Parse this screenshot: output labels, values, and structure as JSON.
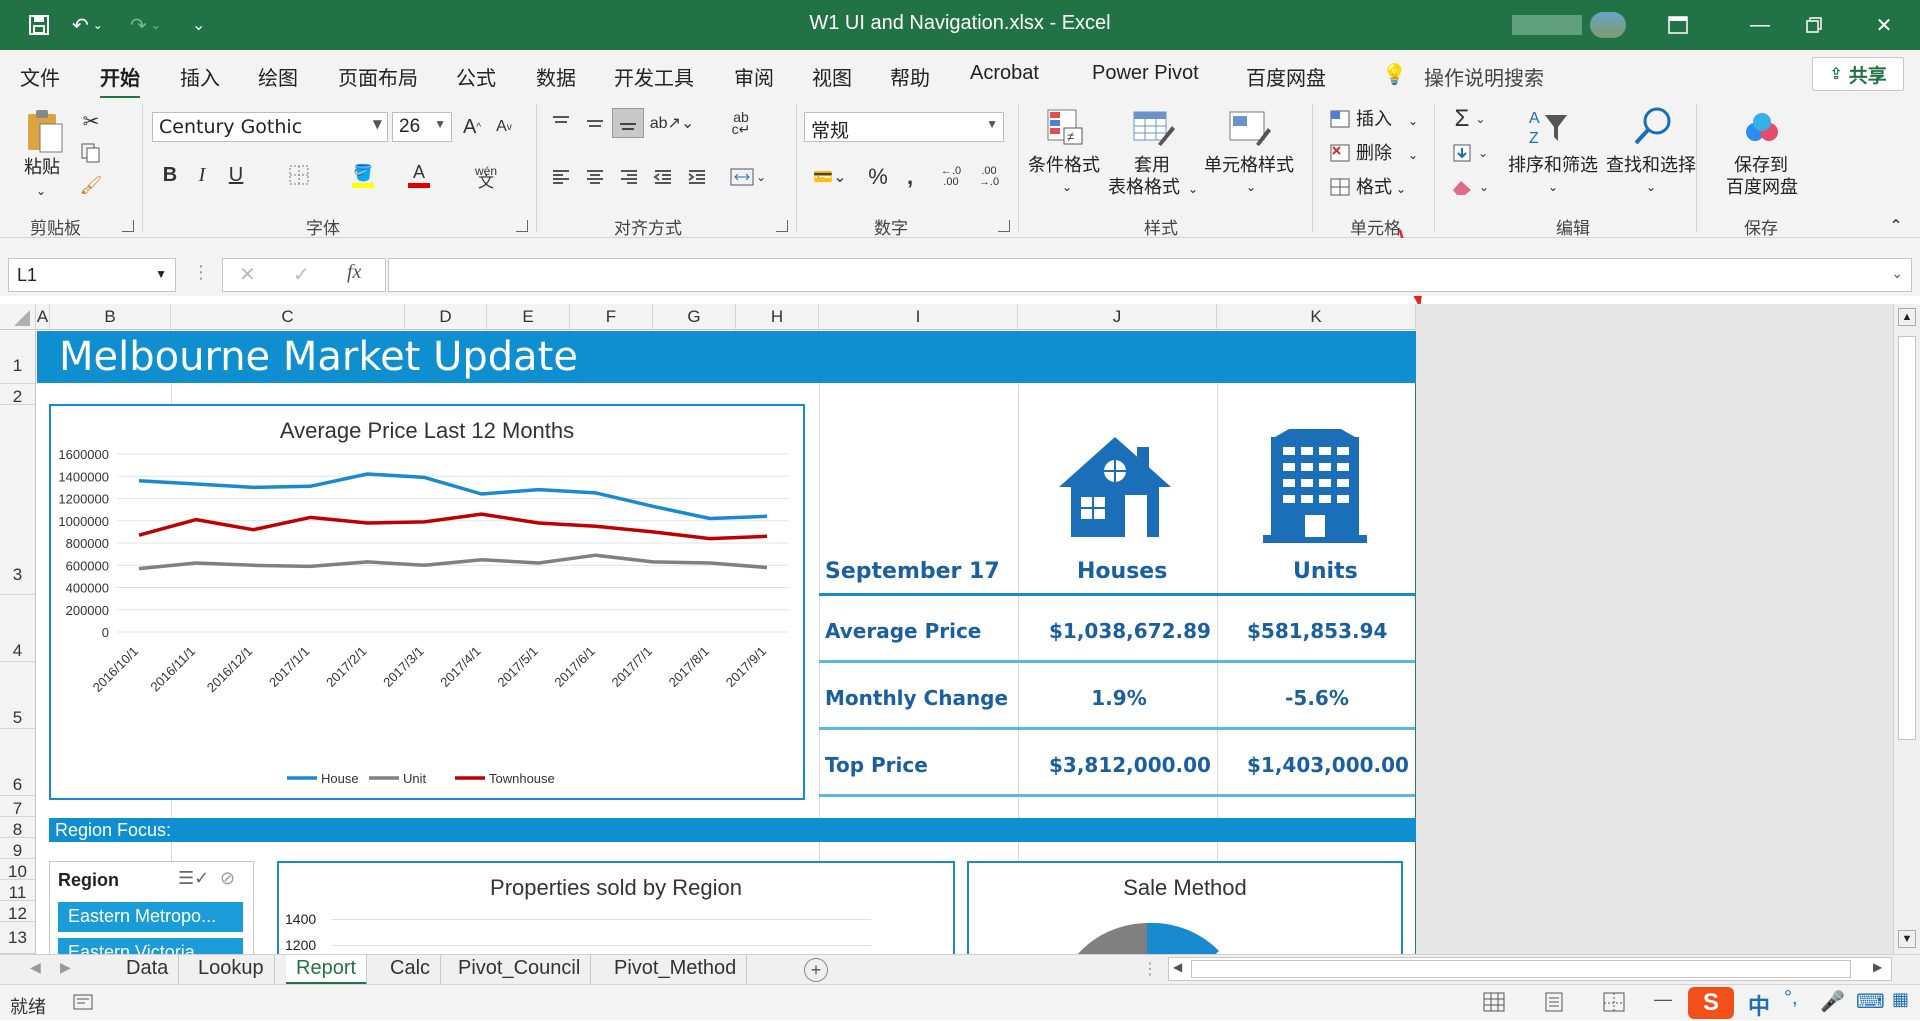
{
  "window": {
    "title": "W1 UI and Navigation.xlsx  -  Excel",
    "accent": "#217346"
  },
  "ribbon_tabs": [
    "文件",
    "开始",
    "插入",
    "绘图",
    "页面布局",
    "公式",
    "数据",
    "开发工具",
    "审阅",
    "视图",
    "帮助",
    "Acrobat",
    "Power Pivot",
    "百度网盘"
  ],
  "active_tab": "开始",
  "tell_me": "操作说明搜索",
  "share_label": "共享",
  "clipboard": {
    "paste": "粘贴",
    "group": "剪贴板"
  },
  "font": {
    "name": "Century Gothic",
    "size": "26",
    "group": "字体"
  },
  "alignment": {
    "group": "对齐方式"
  },
  "number": {
    "format": "常规",
    "group": "数字"
  },
  "styles": {
    "conditional": "条件格式",
    "table_line1": "套用",
    "table_line2": "表格格式",
    "cell_styles": "单元格样式",
    "group": "样式"
  },
  "cells": {
    "insert": "插入",
    "delete": "删除",
    "format": "格式",
    "group": "单元格"
  },
  "editing": {
    "sort": "排序和筛选",
    "find": "查找和选择",
    "group": "编辑"
  },
  "save": {
    "line1": "保存到",
    "line2": "百度网盘",
    "group": "保存"
  },
  "formula_bar": {
    "name_box": "L1",
    "formula": ""
  },
  "columns": [
    "A",
    "B",
    "C",
    "D",
    "E",
    "F",
    "G",
    "H",
    "I",
    "J",
    "K"
  ],
  "rows": [
    "1",
    "2",
    "3",
    "4",
    "5",
    "6",
    "7",
    "8",
    "9",
    "10",
    "11",
    "12",
    "13"
  ],
  "report": {
    "banner": "Melbourne Market Update",
    "period": "September 17",
    "col_houses": "Houses",
    "col_units": "Units",
    "rows": [
      {
        "label": "Average Price",
        "houses": "$1,038,672.89",
        "units": "$581,853.94"
      },
      {
        "label": "Monthly Change",
        "houses": "1.9%",
        "units": "-5.6%"
      },
      {
        "label": "Top Price",
        "houses": "$3,812,000.00",
        "units": "$1,403,000.00"
      }
    ],
    "region_focus": "Region Focus:",
    "slicer": {
      "title": "Region",
      "items": [
        "Eastern Metropo...",
        "Eastern Victoria"
      ]
    },
    "chart2_title": "Properties sold by Region",
    "chart2_ticks": [
      "1400",
      "1200"
    ],
    "chart3_title": "Sale Method",
    "colors": {
      "house": "#1a8ad0",
      "unit": "#808080",
      "townhouse": "#c00000",
      "stat_text": "#1a5fa0"
    }
  },
  "chart_data": {
    "type": "line",
    "title": "Average Price Last 12 Months",
    "categories": [
      "2016/10/1",
      "2016/11/1",
      "2016/12/1",
      "2017/1/1",
      "2017/2/1",
      "2017/3/1",
      "2017/4/1",
      "2017/5/1",
      "2017/6/1",
      "2017/7/1",
      "2017/8/1",
      "2017/9/1"
    ],
    "series": [
      {
        "name": "House",
        "color": "#1a8ad0",
        "values": [
          1360000,
          1330000,
          1300000,
          1310000,
          1420000,
          1390000,
          1240000,
          1280000,
          1250000,
          1130000,
          1020000,
          1040000
        ]
      },
      {
        "name": "Unit",
        "color": "#808080",
        "values": [
          570000,
          620000,
          600000,
          590000,
          630000,
          600000,
          650000,
          620000,
          690000,
          630000,
          620000,
          580000
        ]
      },
      {
        "name": "Townhouse",
        "color": "#c00000",
        "values": [
          870000,
          1010000,
          920000,
          1030000,
          980000,
          990000,
          1060000,
          980000,
          950000,
          900000,
          840000,
          860000
        ]
      }
    ],
    "yticks": [
      "1600000",
      "1400000",
      "1200000",
      "1000000",
      "800000",
      "600000",
      "400000",
      "200000",
      "0"
    ],
    "ylim": [
      0,
      1600000
    ],
    "legend_position": "bottom",
    "grid": true
  },
  "sheet_tabs": [
    "Data",
    "Lookup",
    "Report",
    "Calc",
    "Pivot_Council",
    "Pivot_Method"
  ],
  "active_sheet": "Report",
  "status": {
    "ready": "就绪"
  },
  "ime": {
    "lang": "中"
  }
}
